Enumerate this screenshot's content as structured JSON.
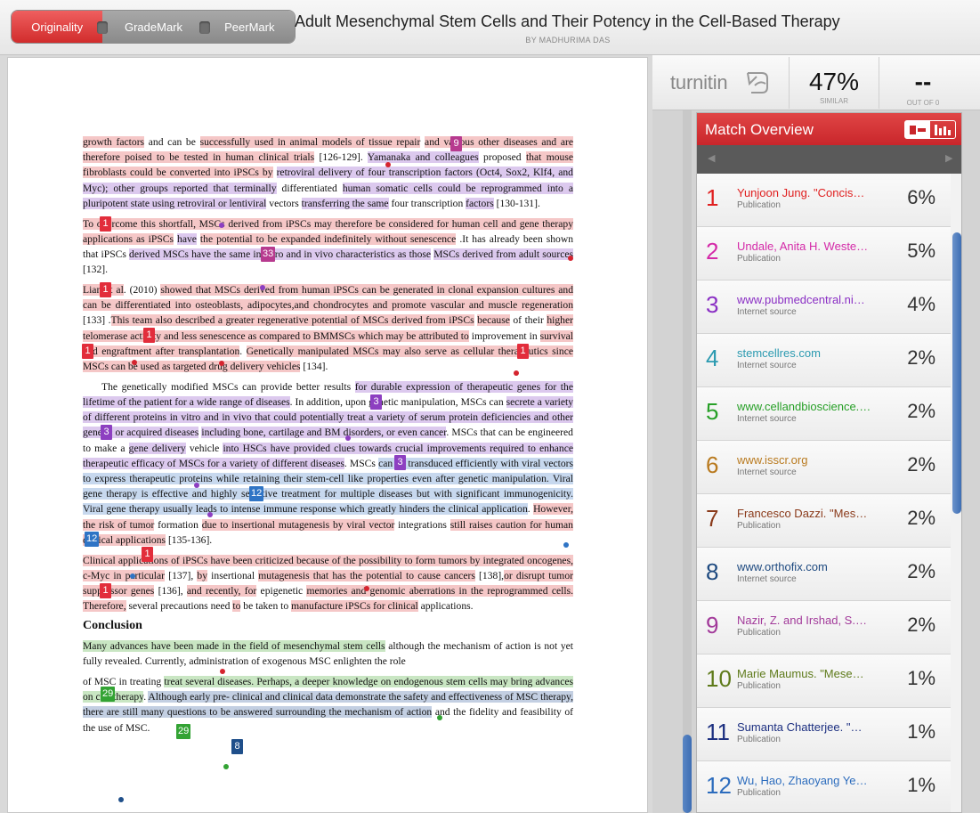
{
  "tabs": [
    "Originality",
    "GradeMark",
    "PeerMark"
  ],
  "document": {
    "title": "Adult Mesenchymal Stem Cells and Their Potency in the Cell-Based Therapy",
    "author": "BY MADHURIMA DAS"
  },
  "report": {
    "logo": "turnitin",
    "similarity": "47%",
    "similarity_label": "SIMILAR",
    "out_of_value": "--",
    "out_of_label": "OUT OF 0"
  },
  "match_overview": {
    "title": "Match Overview",
    "items": [
      {
        "num": "1",
        "name": "Yunjoon Jung. \"Concis…",
        "type": "Publication",
        "pct": "6%",
        "color": "#e02020"
      },
      {
        "num": "2",
        "name": "Undale, Anita H. Weste…",
        "type": "Publication",
        "pct": "5%",
        "color": "#d42aa8"
      },
      {
        "num": "3",
        "name": "www.pubmedcentral.ni…",
        "type": "Internet source",
        "pct": "4%",
        "color": "#8a2fc4"
      },
      {
        "num": "4",
        "name": "stemcellres.com",
        "type": "Internet source",
        "pct": "2%",
        "color": "#2b9ab0"
      },
      {
        "num": "5",
        "name": "www.cellandbioscience.…",
        "type": "Internet source",
        "pct": "2%",
        "color": "#28a028"
      },
      {
        "num": "6",
        "name": "www.isscr.org",
        "type": "Internet source",
        "pct": "2%",
        "color": "#b97a1f"
      },
      {
        "num": "7",
        "name": "Francesco Dazzi. \"Mes…",
        "type": "Publication",
        "pct": "2%",
        "color": "#8a3a1a"
      },
      {
        "num": "8",
        "name": "www.orthofix.com",
        "type": "Internet source",
        "pct": "2%",
        "color": "#1e4a80"
      },
      {
        "num": "9",
        "name": "Nazir, Z. and Irshad, S.…",
        "type": "Publication",
        "pct": "2%",
        "color": "#a23a9a"
      },
      {
        "num": "10",
        "name": "Marie Maumus. \"Mese…",
        "type": "Publication",
        "pct": "1%",
        "color": "#5e7a1a"
      },
      {
        "num": "11",
        "name": "Sumanta Chatterjee. \"…",
        "type": "Publication",
        "pct": "1%",
        "color": "#1c2f80"
      },
      {
        "num": "12",
        "name": "Wu, Hao, Zhaoyang Ye…",
        "type": "Publication",
        "pct": "1%",
        "color": "#2c6cbd"
      }
    ]
  },
  "paper": {
    "p1": "growth factors and can be successfully used in animal models of tissue repair and various other diseases and are therefore poised to be tested in human clinical trials [126-129]. Yamanaka and colleagues proposed that mouse fibroblasts could be converted into iPSCs by retroviral delivery of four transcription factors (Oct4, Sox2, Klf4, and Myc); other groups reported that terminally differentiated human somatic cells could be reprogrammed into a pluripotent state using retroviral or lentiviral vectors transferring the same four transcription factors [130-131].",
    "p2": "To overcome this shortfall, MSCs derived from iPSCs may therefore be considered for human cell and gene therapy applications as iPSCs have the potential to be expanded indefinitely without senescence .It has already been shown that iPSCs derived MSCs have the same in vitro and in vivo characteristics as those MSCs derived from adult sources [132].",
    "p3": "Lian et al. (2010) showed that MSCs derived from human iPSCs can be generated in clonal expansion cultures and can be differentiated into osteoblasts, adipocytes,and chondrocytes and promote vascular and muscle regeneration [133] .This team also described a greater regenerative potential of MSCs derived from iPSCs because of their higher telomerase activity and less senescence as compared to BMMSCs which may be attributed to improvement in survival and engraftment after transplantation. Genetically manipulated MSCs may also serve as cellular therapeutics since MSCs can be used as targeted drug delivery vehicles [134].",
    "p4": "The genetically modified MSCs can provide better results for durable expression of therapeutic genes for the lifetime of the patient for a wide range of diseases. In addition, upon genetic manipulation, MSCs can secrete a variety of different proteins in vitro and in vivo that could potentially treat a variety of serum protein deficiencies and other genetic or acquired diseases including bone, cartilage and BM disorders, or even cancer. MSCs that can be engineered to make a gene delivery vehicle into HSCs have provided clues towards crucial improvements required to enhance therapeutic efficacy of MSCs for a variety of different diseases. MSCs can be transduced efficiently with viral vectors to express therapeutic proteins while retaining their stem-cell like properties even after genetic manipulation. Viral gene therapy is effective and highly selective treatment for multiple diseases but with significant immunogenicity. Viral gene therapy usually leads to intense immune response which greatly hinders the clinical application. However, the risk of tumor formation due to insertional mutagenesis by viral vector integrations still raises caution for human clinical applications [135-136].",
    "p5": "Clinical applications of iPSCs have been criticized because of the possibility to form tumors by integrated oncogenes, c-Myc in particular [137], by insertional mutagenesis that has the potential to cause cancers [138],or disrupt tumor suppressor genes [136], and recently, for epigenetic memories and genomic aberrations in the reprogrammed cells. Therefore, several precautions need to be taken to manufacture iPSCs for clinical applications.",
    "heading": "Conclusion",
    "p6": "Many advances have been made in the field of mesenchymal stem cells although the mechanism of action is not yet fully revealed. Currently, administration of exogenous MSC enlighten the role",
    "p7": "of MSC in treating treat several diseases. Perhaps, a deeper knowledge on endogenous stem cells may bring advances on cell therapy. Although early pre- clinical and clinical data demonstrate the safety and effectiveness of MSC therapy, there are still many questions to be answered surrounding the mechanism of action and the fidelity and feasibility of the use of MSC."
  },
  "markers": [
    {
      "label": "9",
      "color": "mag"
    },
    {
      "label": "1",
      "color": "red"
    },
    {
      "label": "33",
      "color": "mag"
    },
    {
      "label": "1",
      "color": "red"
    },
    {
      "label": "1",
      "color": "red"
    },
    {
      "label": "1",
      "color": "red"
    },
    {
      "label": "1",
      "color": "red"
    },
    {
      "label": "3",
      "color": "pur"
    },
    {
      "label": "3",
      "color": "pur"
    },
    {
      "label": "3",
      "color": "pur"
    },
    {
      "label": "12",
      "color": "blu"
    },
    {
      "label": "12",
      "color": "blu"
    },
    {
      "label": "1",
      "color": "red"
    },
    {
      "label": "1",
      "color": "red"
    },
    {
      "label": "29",
      "color": "grn"
    },
    {
      "label": "29",
      "color": "grn"
    },
    {
      "label": "8",
      "color": "navy"
    }
  ]
}
